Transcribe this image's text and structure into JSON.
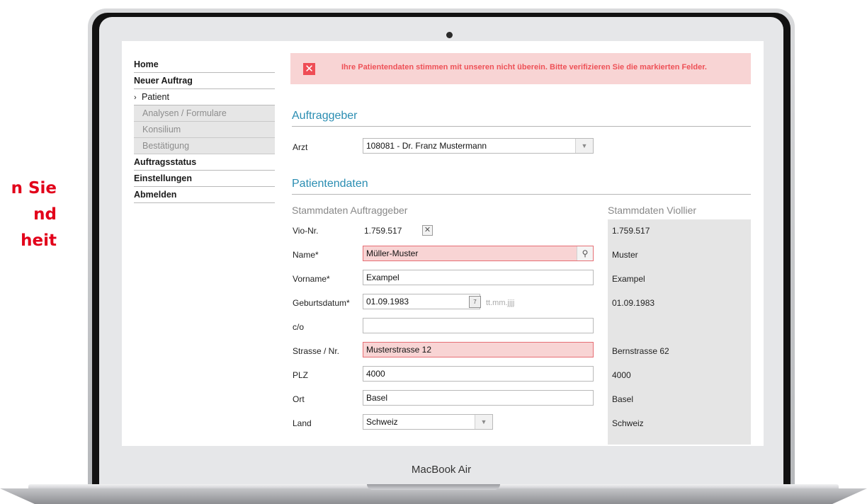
{
  "promo_text_lines": [
    "n Sie",
    "nd",
    "heit"
  ],
  "device_brand": "MacBook Air",
  "nav": [
    {
      "label": "Home",
      "type": "bold"
    },
    {
      "label": "Neuer Auftrag",
      "type": "bold"
    },
    {
      "label": "Patient",
      "type": "current"
    },
    {
      "label": "Analysen / Formulare",
      "type": "sub"
    },
    {
      "label": "Konsilium",
      "type": "sub"
    },
    {
      "label": "Bestätigung",
      "type": "sub"
    },
    {
      "label": "Auftragsstatus",
      "type": "bold"
    },
    {
      "label": "Einstellungen",
      "type": "bold"
    },
    {
      "label": "Abmelden",
      "type": "bold"
    }
  ],
  "error_message": "Ihre Patientendaten stimmen mit unseren nicht überein. Bitte verifizieren Sie die markierten Felder.",
  "section_auftraggeber": "Auftraggeber",
  "arzt_label": "Arzt",
  "arzt_value": "108081 - Dr. Franz Mustermann",
  "section_patient": "Patientendaten",
  "col_left_title": "Stammdaten Auftraggeber",
  "col_right_title": "Stammdaten Viollier",
  "vio_label": "Vio-Nr.",
  "vio_value": "1.759.517",
  "fields": {
    "name": {
      "label": "Name*",
      "value": "Müller-Muster",
      "viollier": "Muster"
    },
    "vorname": {
      "label": "Vorname*",
      "value": "Exampel",
      "viollier": "Exampel"
    },
    "geburtsdatum": {
      "label": "Geburtsdatum*",
      "value": "01.09.1983",
      "hint": "tt.mm.jjjj",
      "viollier": "01.09.1983"
    },
    "co": {
      "label": "c/o",
      "value": "",
      "viollier": ""
    },
    "strasse": {
      "label": "Strasse / Nr.",
      "value": "Musterstrasse 12",
      "viollier": "Bernstrasse 62"
    },
    "plz": {
      "label": "PLZ",
      "value": "4000",
      "viollier": "4000"
    },
    "ort": {
      "label": "Ort",
      "value": "Basel",
      "viollier": "Basel"
    },
    "land": {
      "label": "Land",
      "value": "Schweiz",
      "viollier": "Schweiz"
    }
  },
  "viollier_vio": "1.759.517",
  "colors": {
    "accent": "#2a8db2",
    "error_bg": "#f8d4d4",
    "error_text": "#ee5157",
    "promo": "#e2001a"
  }
}
